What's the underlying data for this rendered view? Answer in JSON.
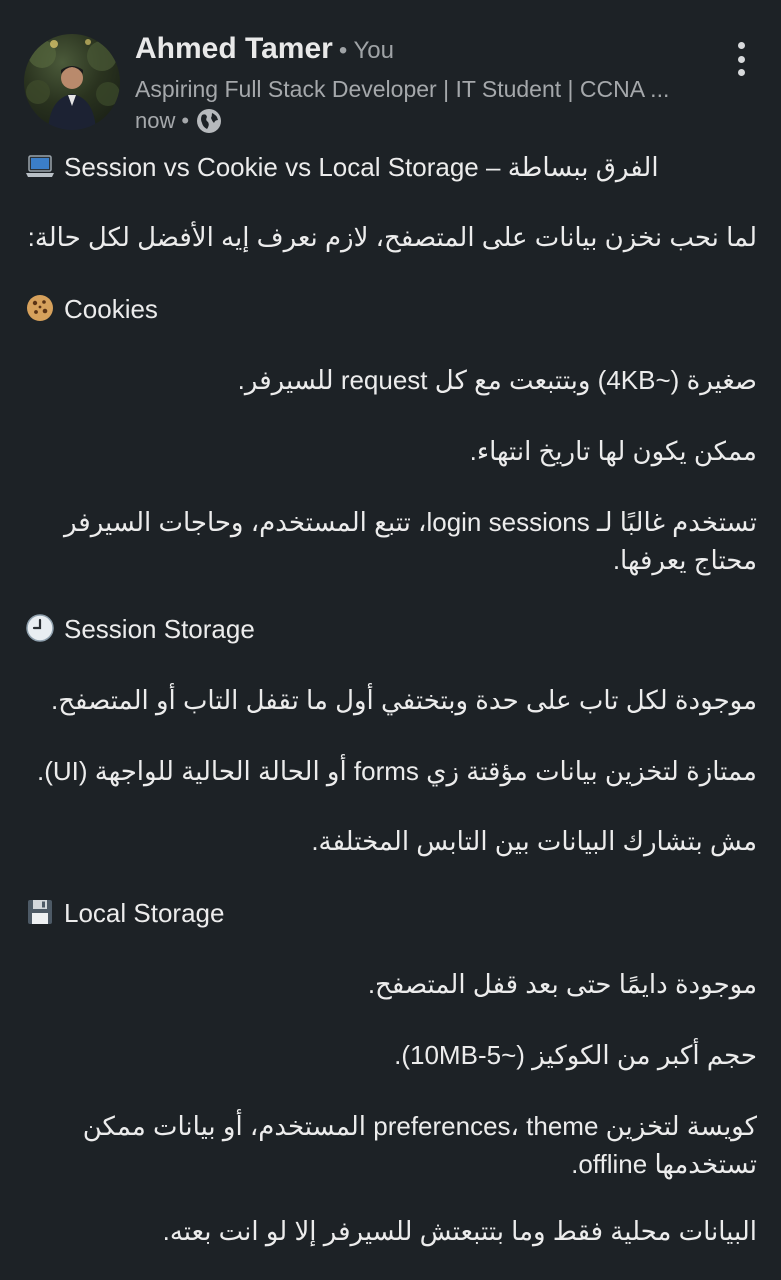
{
  "post": {
    "author": {
      "name": "Ahmed Tamer",
      "you_tag": "• You",
      "headline": "Aspiring Full Stack Developer | IT Student | CCNA ...",
      "time": "now",
      "time_dot": "•",
      "visibility_icon": "globe-icon"
    },
    "menu_icon": "more-vertical-icon",
    "lines": {
      "title": "Session vs Cookie vs Local Storage – الفرق ببساطة",
      "intro": "لما نحب نخزن بيانات على المتصفح، لازم نعرف إيه الأفضل لكل حالة:",
      "cookies_heading": "Cookies",
      "cookies_1": "صغيرة (~4KB) وبتتبعت مع كل request للسيرفر.",
      "cookies_2": "ممكن يكون لها تاريخ انتهاء.",
      "cookies_3a": "تستخدم غالبًا لـ login sessions، تتبع المستخدم، وحاجات السيرفر",
      "cookies_3b": "محتاج يعرفها.",
      "session_heading": "Session Storage",
      "session_1": "موجودة لكل تاب على حدة وبتختفي أول ما تقفل التاب أو المتصفح.",
      "session_2": "ممتازة لتخزين بيانات مؤقتة زي forms أو الحالة الحالية للواجهة (UI).",
      "session_3": "مش بتشارك البيانات بين التابس المختلفة.",
      "local_heading": "Local Storage",
      "local_1": "موجودة دايمًا حتى بعد قفل المتصفح.",
      "local_2": "حجم أكبر من الكوكيز (~5-10MB).",
      "local_3a": "كويسة لتخزين preferences، theme المستخدم، أو بيانات ممكن",
      "local_3b": "تستخدمها offline.",
      "local_4": "البيانات محلية فقط وما بتتبعتش للسيرفر إلا لو انت بعته."
    },
    "icons": {
      "title": "laptop-icon",
      "cookies": "cookie-icon",
      "session": "clock-icon",
      "local": "floppy-disk-icon"
    }
  }
}
